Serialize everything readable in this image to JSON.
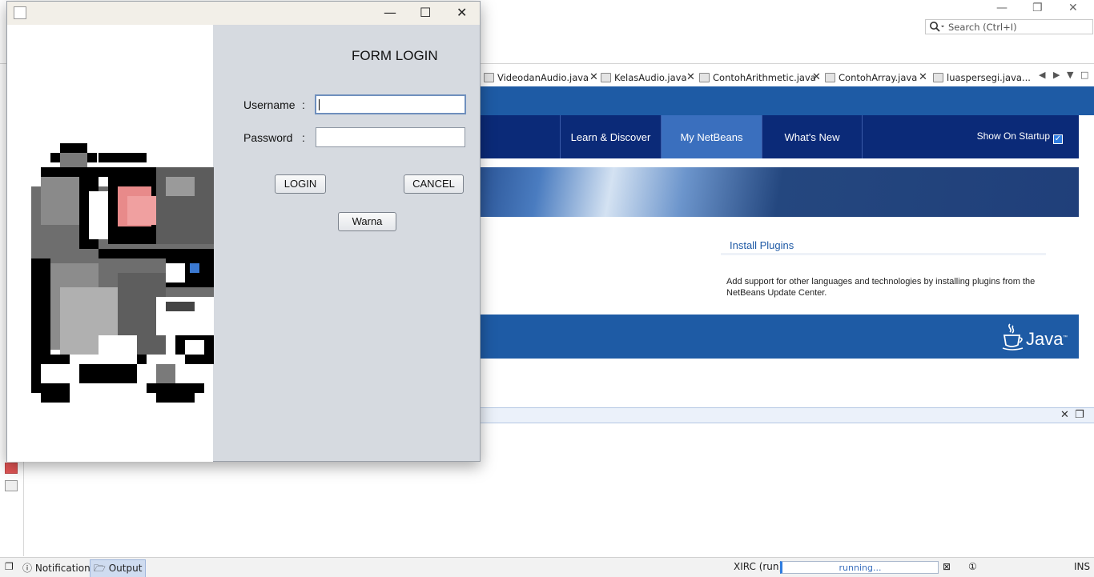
{
  "ide": {
    "search_placeholder": "Search (Ctrl+I)",
    "tabs": [
      {
        "label": "VideodanAudio.java"
      },
      {
        "label": "KelasAudio.java"
      },
      {
        "label": "ContohArithmetic.java"
      },
      {
        "label": "ContohArray.java"
      },
      {
        "label": "luaspersegi.java..."
      }
    ],
    "start_page": {
      "nav": [
        "Learn & Discover",
        "My NetBeans",
        "What's New"
      ],
      "active_nav": "My NetBeans",
      "show_on_startup": "Show On Startup",
      "show_on_startup_checked": true,
      "install_plugins_title": "Install Plugins",
      "install_plugins_text": "Add support for other languages and technologies by installing plugins from the NetBeans Update Center.",
      "java_logo_text": "Java"
    },
    "statusbar": {
      "notifications": "Notifications",
      "output": "Output",
      "run_label": "XIRC (run)",
      "progress_text": "running...",
      "mode": "INS"
    }
  },
  "dialog": {
    "title": "FORM LOGIN",
    "username_label": "Username",
    "password_label": "Password",
    "colon": ":",
    "username_value": "",
    "password_value": "",
    "login_button": "LOGIN",
    "cancel_button": "CANCEL",
    "warna_button": "Warna"
  },
  "colors": {
    "dialog_bg": "#d6dae0",
    "nav_bg": "#0b2a78",
    "nav_active": "#3a6fbe",
    "brand_blue": "#1e5ba5"
  }
}
